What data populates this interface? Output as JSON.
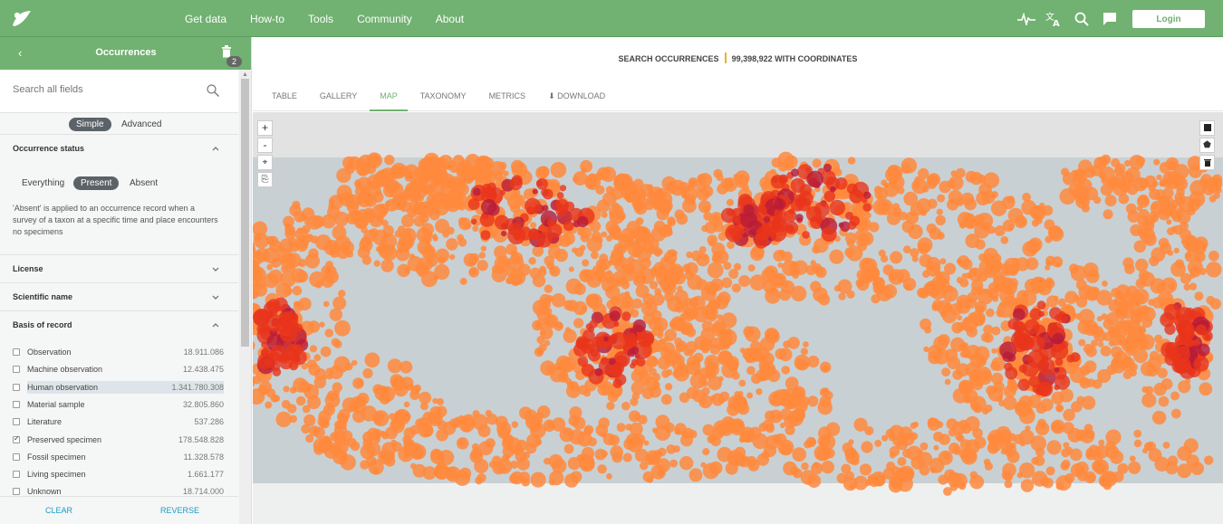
{
  "nav": {
    "items": [
      "Get data",
      "How-to",
      "Tools",
      "Community",
      "About"
    ],
    "login": "Login"
  },
  "sidebar": {
    "title": "Occurrences",
    "back": "‹",
    "filter_count": "2",
    "search_placeholder": "Search all fields",
    "modes": [
      "Simple",
      "Advanced"
    ],
    "active_mode": "Simple",
    "occurrence_status": {
      "label": "Occurrence status",
      "options": [
        "Everything",
        "Present",
        "Absent"
      ],
      "selected": "Present",
      "description": "'Absent' is applied to an occurrence record when a survey of a taxon at a specific time and place encounters no specimens"
    },
    "sections": [
      "License",
      "Scientific name"
    ],
    "basis_of_record": {
      "label": "Basis of record",
      "items": [
        {
          "label": "Observation",
          "count": "18.911.086",
          "checked": false
        },
        {
          "label": "Machine observation",
          "count": "12.438.475",
          "checked": false
        },
        {
          "label": "Human observation",
          "count": "1.341.780.308",
          "checked": false
        },
        {
          "label": "Material sample",
          "count": "32.805.860",
          "checked": false
        },
        {
          "label": "Literature",
          "count": "537.286",
          "checked": false
        },
        {
          "label": "Preserved specimen",
          "count": "178.548.828",
          "checked": true
        },
        {
          "label": "Fossil specimen",
          "count": "11.328.578",
          "checked": false
        },
        {
          "label": "Living specimen",
          "count": "1.661.177",
          "checked": false
        },
        {
          "label": "Unknown",
          "count": "18.714.000",
          "checked": false
        }
      ]
    },
    "clear": "CLEAR",
    "reverse": "REVERSE"
  },
  "main": {
    "headline_left": "SEARCH OCCURRENCES",
    "headline_right": "99,398,922 WITH COORDINATES",
    "tabs": [
      "TABLE",
      "GALLERY",
      "MAP",
      "TAXONOMY",
      "METRICS",
      "DOWNLOAD"
    ],
    "active_tab": "MAP"
  },
  "colors": {
    "brand": "#71b171",
    "link": "#1a9dc3",
    "dot_light": "#ff8a3d",
    "dot_dark": "#e8341c",
    "dot_darkest": "#b81c3a",
    "land": "#c9d0d3"
  }
}
